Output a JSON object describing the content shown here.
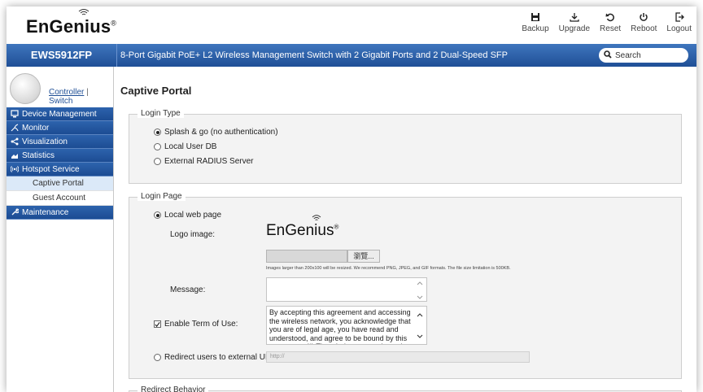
{
  "header": {
    "brand": "EnGenius",
    "toolbar": [
      {
        "icon": "save-icon",
        "label": "Backup"
      },
      {
        "icon": "upgrade-icon",
        "label": "Upgrade"
      },
      {
        "icon": "reset-icon",
        "label": "Reset"
      },
      {
        "icon": "power-icon",
        "label": "Reboot"
      },
      {
        "icon": "logout-icon",
        "label": "Logout"
      }
    ]
  },
  "bar": {
    "model": "EWS5912FP",
    "description": "8-Port Gigabit PoE+ L2 Wireless Management Switch with 2 Gigabit Ports and 2 Dual-Speed SFP",
    "search_placeholder": "Search"
  },
  "sidebar": {
    "controller_label": "Controller",
    "separator": "|",
    "switch_label": "Switch",
    "menu": [
      {
        "icon": "device-management-icon",
        "label": "Device Management"
      },
      {
        "icon": "monitor-icon",
        "label": "Monitor"
      },
      {
        "icon": "visualization-icon",
        "label": "Visualization"
      },
      {
        "icon": "statistics-icon",
        "label": "Statistics"
      },
      {
        "icon": "hotspot-icon",
        "label": "Hotspot Service"
      },
      {
        "label": "Captive Portal",
        "active": true
      },
      {
        "label": "Guest Account"
      },
      {
        "icon": "maintenance-icon",
        "label": "Maintenance"
      }
    ]
  },
  "main": {
    "title": "Captive Portal",
    "login_type": {
      "legend": "Login Type",
      "options": [
        "Splash & go (no authentication)",
        "Local User DB",
        "External RADIUS Server"
      ],
      "selected": 0
    },
    "login_page": {
      "legend": "Login Page",
      "local_web_page_label": "Local web page",
      "logo_label": "Logo image:",
      "logo_brand": "EnGenius",
      "browse_label": "瀏覽...",
      "image_hint": "Images larger than 200x100 will be resized. We recommend PNG, JPEG, and GIF formats. The file size limitation is 500KB.",
      "message_label": "Message:",
      "message_value": "",
      "terms_label": "Enable Term of Use:",
      "terms_checked": true,
      "terms_text": "By accepting this agreement and accessing the wireless network, you acknowledge that you are of legal age, you have read and understood, and agree to be bound by this agreement.(*) The wireless network service is provided by the",
      "redirect_label": "Redirect users to external URL:",
      "redirect_placeholder": "http://"
    },
    "redirect_behavior": {
      "legend": "Redirect Behavior"
    }
  }
}
